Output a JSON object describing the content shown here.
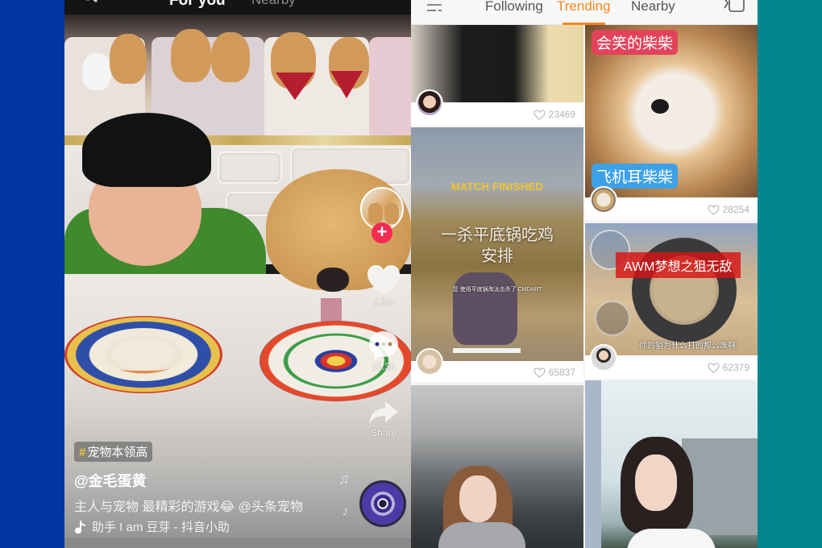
{
  "left_app": {
    "header": {
      "tabs": [
        {
          "label": "For you",
          "active": true
        },
        {
          "label": "Nearby",
          "active": false
        }
      ],
      "search_icon": "search-icon",
      "live_icon": "live-icon"
    },
    "side_actions": {
      "follow_icon": "plus-icon",
      "likes": "1.5m",
      "comments": "11.3k",
      "share_label": "Share"
    },
    "video_info": {
      "hashtag_symbol": "#",
      "hashtag": "宠物本领高",
      "username": "@金毛蛋黄",
      "caption": "主人与宠物 最精彩的游戏😂 @头条宠物",
      "music": "助手    I am 豆芽 - 抖音小助"
    },
    "colors": {
      "follow_red": "#f42b52",
      "hashtag_yellow": "#f2c53d"
    }
  },
  "right_app": {
    "header": {
      "tabs": [
        {
          "label": "Following",
          "active": false
        },
        {
          "label": "Trending",
          "active": true
        },
        {
          "label": "Nearby",
          "active": false
        }
      ],
      "menu_icon": "menu-icon",
      "camera_icon": "camera-icon"
    },
    "accent": "#f5881f",
    "cards": [
      {
        "id": "guitar",
        "likes": "23469",
        "overlay": []
      },
      {
        "id": "shiba",
        "likes": "28254",
        "overlay": [
          "会笑的柴柴",
          "飞机耳柴柴"
        ]
      },
      {
        "id": "match",
        "likes": "65837",
        "overlay": [
          "MATCH FINISHED",
          "一杀平底锅吃鸡",
          "安排",
          "您 使用平底锅淘汰击杀了 CMDART"
        ]
      },
      {
        "id": "awm",
        "likes": "62379",
        "overlay": [
          "AWM梦想之狙无敌",
          "你的狙为什么打的那么准啊"
        ]
      },
      {
        "id": "girl-office",
        "likes": "",
        "overlay": []
      },
      {
        "id": "girl-city",
        "likes": "",
        "overlay": []
      }
    ]
  }
}
